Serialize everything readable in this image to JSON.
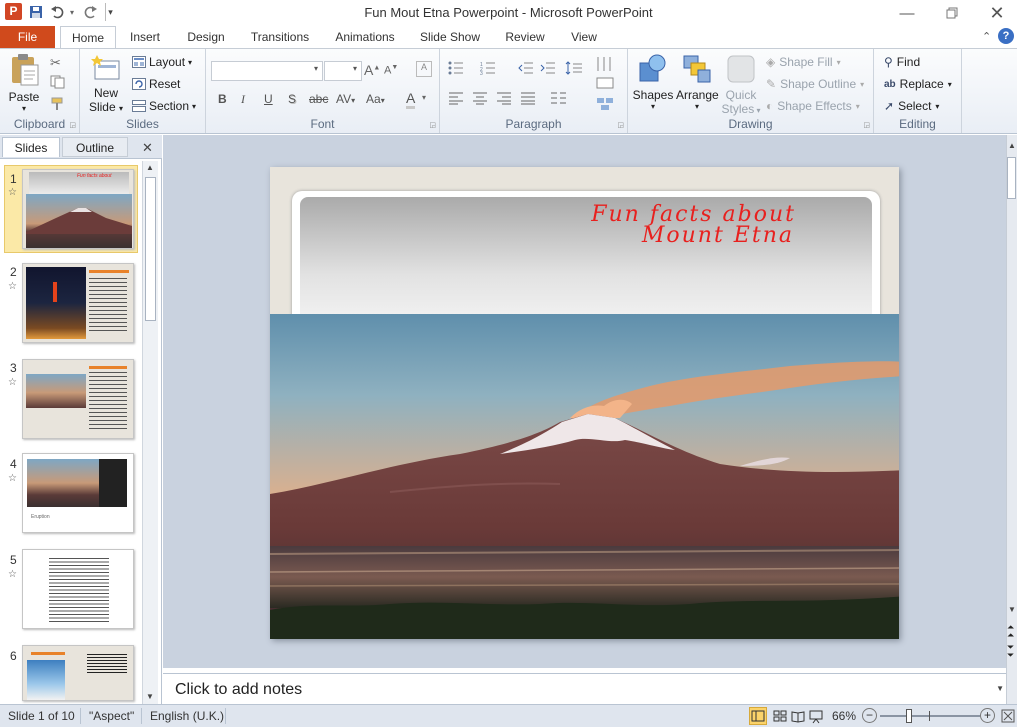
{
  "app": {
    "title": "Fun Mout Etna Powerpoint  -  Microsoft PowerPoint",
    "logo_letter": "P"
  },
  "quick_access": {
    "save": "save-icon",
    "undo": "undo-icon",
    "redo": "redo-icon",
    "customize": "customize-icon"
  },
  "tabs": [
    "File",
    "Home",
    "Insert",
    "Design",
    "Transitions",
    "Animations",
    "Slide Show",
    "Review",
    "View"
  ],
  "ribbon": {
    "clipboard": {
      "paste": "Paste",
      "label": "Clipboard"
    },
    "slides": {
      "new_slide_1": "New",
      "new_slide_2": "Slide",
      "layout": "Layout",
      "reset": "Reset",
      "section": "Section",
      "label": "Slides"
    },
    "font": {
      "label": "Font",
      "bold": "B",
      "italic": "I",
      "underline": "U",
      "shadow": "S",
      "strike": "abc",
      "spacing": "AV",
      "case": "Aa",
      "color": "A",
      "grow": "A",
      "shrink": "A"
    },
    "paragraph": {
      "label": "Paragraph"
    },
    "drawing": {
      "shapes": "Shapes",
      "arrange": "Arrange",
      "quick_styles_1": "Quick",
      "quick_styles_2": "Styles",
      "shape_fill": "Shape Fill",
      "shape_outline": "Shape Outline",
      "shape_effects": "Shape Effects",
      "label": "Drawing"
    },
    "editing": {
      "find": "Find",
      "replace": "Replace",
      "select": "Select",
      "label": "Editing"
    }
  },
  "left_pane": {
    "tabs": [
      "Slides",
      "Outline"
    ],
    "thumbnail_numbers": [
      "1",
      "2",
      "3",
      "4",
      "5",
      "6"
    ],
    "thumb4_caption": "Eruption"
  },
  "slide": {
    "title_line1": "Fun facts about",
    "title_line2": "Mount Etna",
    "title_color": "#e8201e"
  },
  "notes_placeholder": "Click to add notes",
  "status": {
    "slide_info": "Slide 1 of 10",
    "theme": "\"Aspect\"",
    "language": "English (U.K.)",
    "zoom": "66%"
  }
}
